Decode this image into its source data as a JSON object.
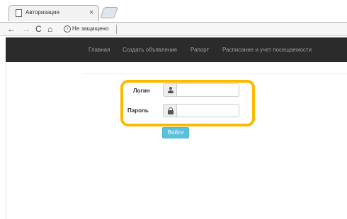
{
  "browser": {
    "tab_title": "Авторизация",
    "tab_close": "×",
    "nav": {
      "back": "←",
      "forward": "→",
      "reload": "C",
      "home": "⌂"
    },
    "security_text": "Не защищено"
  },
  "topnav": {
    "items": [
      {
        "label": "Главная"
      },
      {
        "label": "Создать объявление"
      },
      {
        "label": "Рапорт"
      },
      {
        "label": "Расписание и учет посещаемости"
      }
    ]
  },
  "form": {
    "login_label": "Логин",
    "password_label": "Пароль",
    "login_value": "",
    "password_value": "",
    "submit_label": "Войти",
    "highlight_color": "#fcb900",
    "button_color": "#5bc0de"
  }
}
